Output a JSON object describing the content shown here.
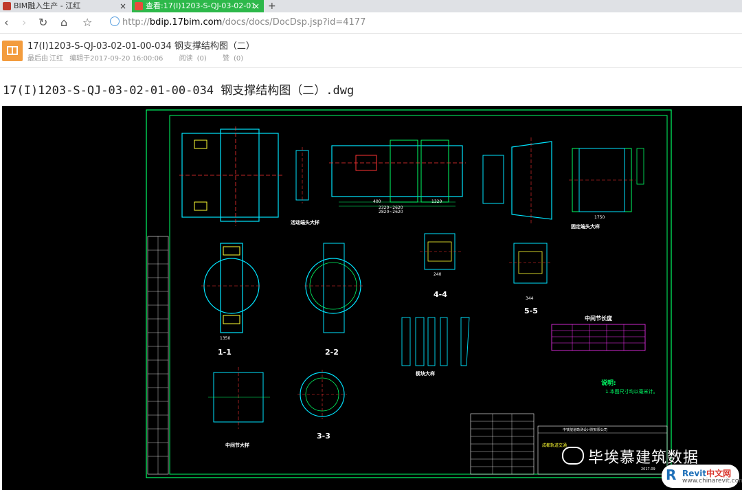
{
  "tabs": [
    {
      "label": "BIM融入生产 - 江红"
    },
    {
      "label": "查看:17(I)1203-S-QJ-03-02-01"
    }
  ],
  "nav": {
    "url_proto": "http://",
    "url_host": "bdip.17bim.com",
    "url_path": "/docs/docs/DocDsp.jsp?id=4177"
  },
  "doc": {
    "title": "17(I)1203-S-QJ-03-02-01-00-034 钢支撑结构图（二）",
    "last_editor_label": "最后由",
    "last_editor": "江红",
    "edited_at": "编辑于2017-09-20 16:00:06",
    "views_label": "阅读",
    "views": "(0)",
    "likes_label": "赞",
    "likes": "(0)"
  },
  "file_heading": "17(I)1203-S-QJ-03-02-01-00-034 钢支撑结构图（二）.dwg",
  "drawing": {
    "labels": {
      "s1": "1-1",
      "s2": "2-2",
      "s3": "3-3",
      "s4": "4-4",
      "s5": "5-5",
      "active_end": "活动端头大样",
      "fixed_end": "固定端头大样",
      "middle_joint": "中间节大样",
      "wedge": "楔块大样",
      "mid_length": "中间节长度",
      "note_title": "说明:",
      "note_1": "1.本图尺寸均以毫米计。",
      "company": "中铁隧道勘测设计院有限公司",
      "project": "成都轨道交通",
      "date": "2017.09"
    },
    "dims": [
      "2820~2620",
      "2320~2620",
      "400",
      "1320",
      "240",
      "344",
      "1750",
      "1350"
    ]
  },
  "watermark": {
    "text": "毕埃慕建筑数据"
  },
  "revit_badge": {
    "title_a": "Revit",
    "title_b": "中文网",
    "url": "www.chinarevit.com"
  },
  "colors": {
    "tab_active": "#2db84a",
    "cad_bg": "#000000",
    "cad_line": "#00ff66",
    "cad_cyan": "#00e5ff",
    "cad_yellow": "#ffff33",
    "cad_magenta": "#ff33ff",
    "cad_red": "#ff3333"
  }
}
